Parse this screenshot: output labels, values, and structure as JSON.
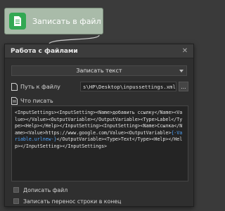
{
  "node": {
    "title": "Записать в файл",
    "icon": "document-icon",
    "icon_color": "#33a853"
  },
  "dialog": {
    "title": "Работа с файлами",
    "close_label": "✕",
    "action": {
      "selected": "Записать текст"
    },
    "path": {
      "label": "Путь к файлу",
      "value": "s\\HP\\Desktop\\inpussettings.xml",
      "browse_label": "..."
    },
    "content": {
      "label": "Что писать",
      "text_before": "<InputSettings><InputSetting><Name>добавить ссылку</Name><Value></Value><OutputVariable></OutputVariable><Type>Label</Type><Help></Help></InputSetting><InputSetting><Name>Ссылка</Name><Value>https://www.google.com/Value><OutputVariable>",
      "variable": "{-Variable.urlnew-}",
      "text_after": "</OutputVariable><Type>Text</Type><Help></Help></InputSetting></InputSettings>"
    },
    "append_label": "Дописать файл",
    "newline_label": "Записать перенос строки в конец"
  }
}
